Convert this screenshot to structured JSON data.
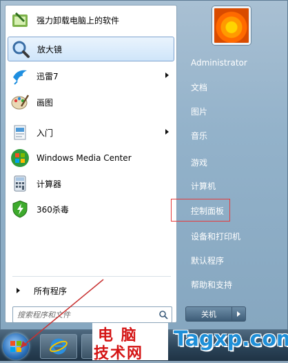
{
  "programs": [
    {
      "label": "强力卸载电脑上的软件",
      "icon": "uninstaller-icon",
      "has_submenu": false
    },
    {
      "label": "放大镜",
      "icon": "magnifier-icon",
      "has_submenu": false,
      "selected": true
    },
    {
      "label": "迅雷7",
      "icon": "thunder-bird-icon",
      "has_submenu": true
    },
    {
      "label": "画图",
      "icon": "paint-palette-icon",
      "has_submenu": false
    },
    {
      "label": "入门",
      "icon": "getting-started-icon",
      "has_submenu": true
    },
    {
      "label": "Windows Media Center",
      "icon": "windows-logo-icon",
      "has_submenu": false
    },
    {
      "label": "计算器",
      "icon": "calculator-icon",
      "has_submenu": false
    },
    {
      "label": "360杀毒",
      "icon": "shield-icon",
      "has_submenu": false
    }
  ],
  "all_programs": {
    "label": "所有程序"
  },
  "search": {
    "placeholder": "搜索程序和文件"
  },
  "places": {
    "user": "Administrator",
    "documents": "文档",
    "pictures": "图片",
    "music": "音乐",
    "games": "游戏",
    "computer": "计算机",
    "control_panel": "控制面板",
    "devices": "设备和打印机",
    "defaults": "默认程序",
    "help": "帮助和支持"
  },
  "shutdown": {
    "label": "关机"
  },
  "watermark": {
    "left_line1": "电 脑",
    "left_line2": "技术网",
    "right": "Tagxp.com"
  },
  "colors": {
    "highlight_box": "#e53b3b",
    "arrow": "#c83232",
    "watermark_red": "#d41414",
    "watermark_blue": "#1e8fd8"
  }
}
